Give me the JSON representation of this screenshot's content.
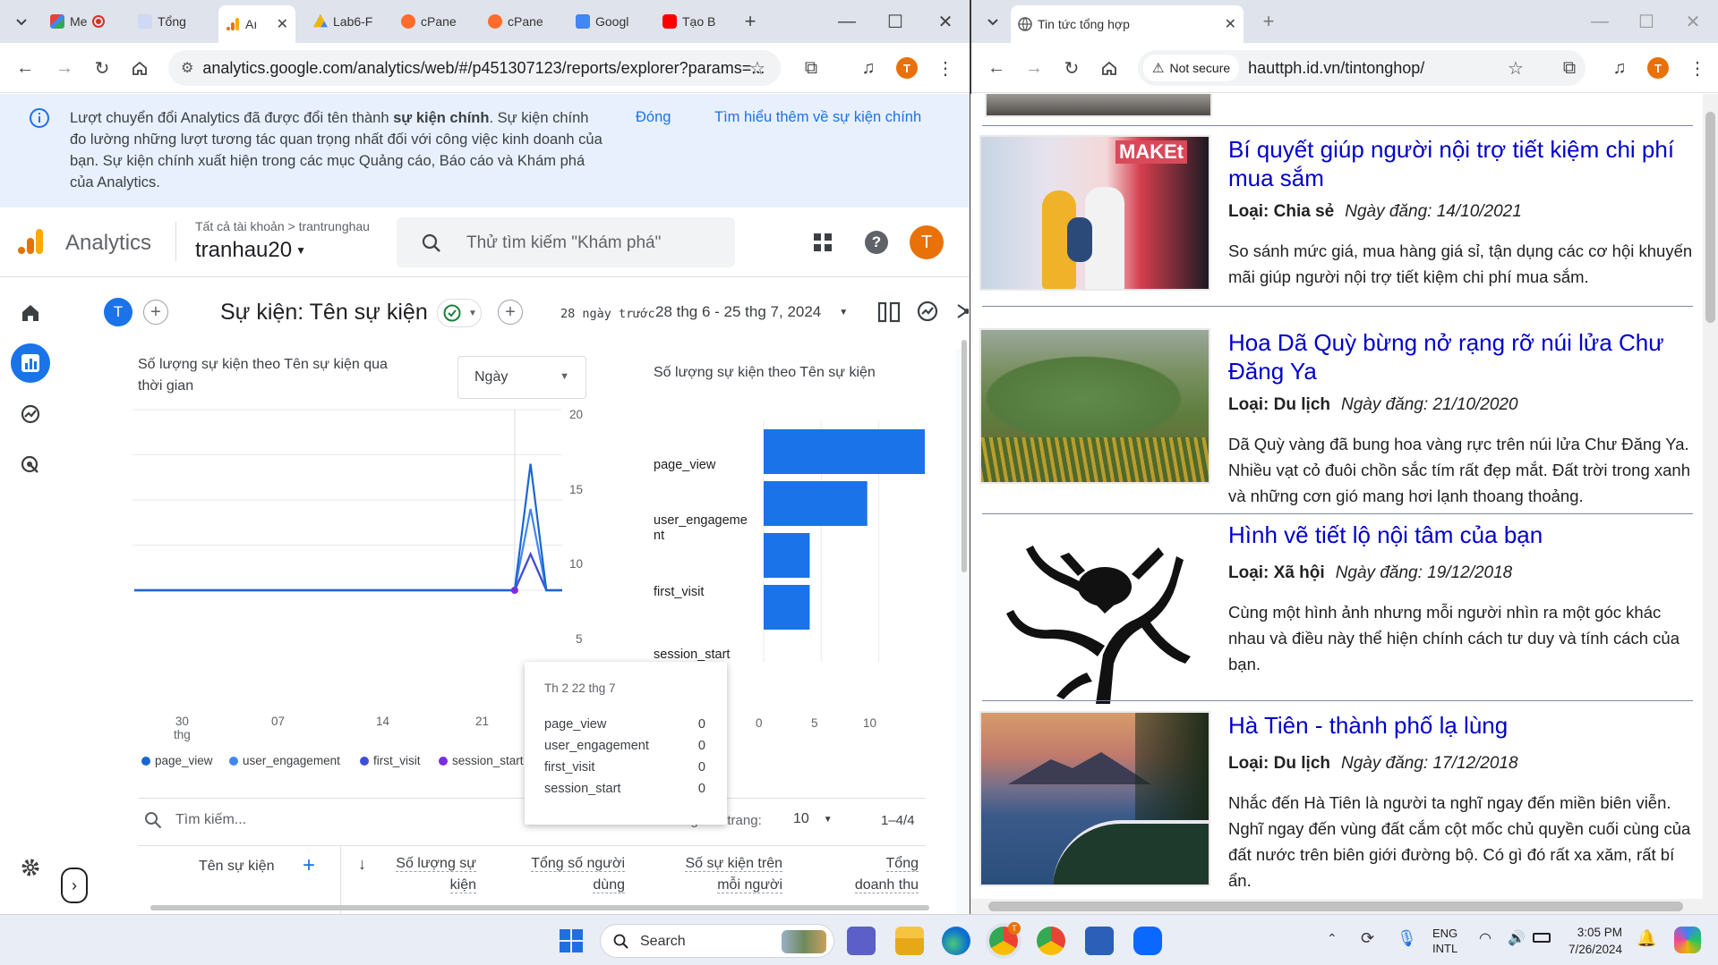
{
  "left_window": {
    "tabs": [
      {
        "label": "Me"
      },
      {
        "label": "Tổng"
      },
      {
        "label": "Aı"
      },
      {
        "label": "Lab6-F"
      },
      {
        "label": "cPane"
      },
      {
        "label": "cPane"
      },
      {
        "label": "Googl"
      },
      {
        "label": "Tạo B"
      }
    ],
    "url": "analytics.google.com/analytics/web/#/p451307123/reports/explorer?params=...",
    "avatar_letter": "T"
  },
  "right_window": {
    "tab_title": "Tin tức tổng hợp",
    "security_label": "Not secure",
    "url": "hauttph.id.vn/tintonghop/",
    "avatar_letter": "T"
  },
  "banner": {
    "text_1": "Lượt chuyển đổi Analytics đã được đổi tên thành ",
    "text_bold": "sự kiện chính",
    "text_2": ". Sự kiện chính đo lường những lượt tương tác quan trọng nhất đối với công việc kinh doanh của bạn. Sự kiện chính xuất hiện trong các mục Quảng cáo, Báo cáo và Khám phá của Analytics.",
    "dismiss": "Đóng",
    "learn_more": "Tìm hiểu thêm về sự kiện chính"
  },
  "ga_header": {
    "app_name": "Analytics",
    "breadcrumb": "Tất cả tài khoản > trantrunghau",
    "property": "tranhau20",
    "search_placeholder": "Thử tìm kiếm \"Khám phá\"",
    "avatar_letter": "T"
  },
  "report": {
    "avatar_letter": "T",
    "title": "Sự kiện: Tên sự kiện",
    "date_prefix": "28 ngày trước",
    "date_range": "28 thg 6 - 25 thg 7, 2024"
  },
  "line_chart": {
    "title": "Số lượng sự kiện theo Tên sự kiện qua thời gian",
    "granularity": "Ngày",
    "y_ticks": [
      "20",
      "15",
      "10",
      "5"
    ],
    "x_ticks": [
      "30 thg",
      "07",
      "14",
      "21"
    ],
    "x_tick_first_line1": "30",
    "x_tick_first_line2": "thg",
    "legend": [
      "page_view",
      "user_engagement",
      "first_visit",
      "session_start"
    ]
  },
  "chart_data": [
    {
      "type": "line",
      "title": "Số lượng sự kiện theo Tên sự kiện qua thời gian",
      "x": [
        "28/6",
        "29/6",
        "30/6",
        "1/7",
        "2/7",
        "3/7",
        "4/7",
        "5/7",
        "6/7",
        "7/7",
        "8/7",
        "9/7",
        "10/7",
        "11/7",
        "12/7",
        "13/7",
        "14/7",
        "15/7",
        "16/7",
        "17/7",
        "18/7",
        "19/7",
        "20/7",
        "21/7",
        "22/7",
        "23/7",
        "24/7",
        "25/7"
      ],
      "ylim": [
        0,
        20
      ],
      "series": [
        {
          "name": "page_view",
          "color": "#1967d2",
          "values": [
            0,
            0,
            0,
            0,
            0,
            0,
            0,
            0,
            0,
            0,
            0,
            0,
            0,
            0,
            0,
            0,
            0,
            0,
            0,
            0,
            0,
            0,
            0,
            0,
            0,
            14,
            0,
            0
          ]
        },
        {
          "name": "user_engagement",
          "color": "#4285f4",
          "values": [
            0,
            0,
            0,
            0,
            0,
            0,
            0,
            0,
            0,
            0,
            0,
            0,
            0,
            0,
            0,
            0,
            0,
            0,
            0,
            0,
            0,
            0,
            0,
            0,
            0,
            9,
            0,
            0
          ]
        },
        {
          "name": "first_visit",
          "color": "#3d4fd6",
          "values": [
            0,
            0,
            0,
            0,
            0,
            0,
            0,
            0,
            0,
            0,
            0,
            0,
            0,
            0,
            0,
            0,
            0,
            0,
            0,
            0,
            0,
            0,
            0,
            0,
            0,
            4,
            0,
            0
          ]
        },
        {
          "name": "session_start",
          "color": "#7b2ee0",
          "values": [
            0,
            0,
            0,
            0,
            0,
            0,
            0,
            0,
            0,
            0,
            0,
            0,
            0,
            0,
            0,
            0,
            0,
            0,
            0,
            0,
            0,
            0,
            0,
            0,
            0,
            4,
            0,
            0
          ]
        }
      ]
    },
    {
      "type": "bar",
      "title": "Số lượng sự kiện theo Tên sự kiện",
      "categories": [
        "page_view",
        "user_engagement",
        "first_visit",
        "session_start"
      ],
      "values": [
        14,
        9,
        4,
        4
      ],
      "x_ticks": [
        "0",
        "5",
        "10"
      ],
      "xlim": [
        0,
        14
      ],
      "color": "#1a73e8"
    }
  ],
  "bar_chart": {
    "title": "Số lượng sự kiện theo Tên sự kiện",
    "label_user_engagement_line1": "user_engageme",
    "label_user_engagement_line2": "nt"
  },
  "tooltip": {
    "date": "Th 2 22 thg 7",
    "rows": [
      {
        "name": "page_view",
        "value": "0"
      },
      {
        "name": "user_engagement",
        "value": "0"
      },
      {
        "name": "first_visit",
        "value": "0"
      },
      {
        "name": "session_start",
        "value": "0"
      }
    ]
  },
  "table": {
    "search_placeholder": "Tìm kiếm...",
    "rows_per_page_label": "Số hàng mỗi trang:",
    "rows_per_page": "10",
    "pagination": "1–4/4",
    "col_event_name": "Tên sự kiện",
    "col_event_count_1": "Số lượng sự",
    "col_event_count_2": "kiện",
    "col_total_users_1": "Tổng số người",
    "col_total_users_2": "dùng",
    "col_per_user_1": "Số sự kiện trên",
    "col_per_user_2": "mỗi người",
    "col_revenue_1": "Tổng",
    "col_revenue_2": "doanh thu"
  },
  "articles": [
    {
      "title": "Bí quyết giúp người nội trợ tiết kiệm chi phí mua sắm",
      "category_label": "Loại: Chia sẻ",
      "date": "Ngày đăng: 14/10/2021",
      "description": "So sánh mức giá, mua hàng giá sỉ, tận dụng các cơ hội khuyến mãi giúp người nội trợ tiết kiệm chi phí mua sắm.",
      "image_text": "MAKEt"
    },
    {
      "title": "Hoa Dã Quỳ bừng nở rạng rỡ núi lửa Chư Đăng Ya",
      "category_label": "Loại: Du lịch",
      "date": "Ngày đăng: 21/10/2020",
      "description": "Dã Quỳ vàng đã bung hoa vàng rực trên núi lửa Chư Đăng Ya. Nhiều vạt cỏ đuôi chồn sắc tím rất đẹp mắt. Đất trời trong xanh và những cơn gió mang hơi lạnh thoang thoảng."
    },
    {
      "title": "Hình vẽ tiết lộ nội tâm của bạn",
      "category_label": "Loại: Xã hội",
      "date": "Ngày đăng: 19/12/2018",
      "description": "Cùng một hình ảnh nhưng mỗi người nhìn ra một góc khác nhau và điều này thể hiện chính cách tư duy và tính cách của bạn."
    },
    {
      "title": "Hà Tiên - thành phố lạ lùng",
      "category_label": "Loại: Du lịch",
      "date": "Ngày đăng: 17/12/2018",
      "description": "Nhắc đến Hà Tiên là người ta nghĩ ngay đến miền biên viễn. Nghĩ ngay đến vùng đất cắm cột mốc chủ quyền cuối cùng của đất nước trên biên giới đường bộ. Có gì đó rất xa xăm, rất bí ẩn."
    }
  ],
  "taskbar": {
    "search_label": "Search",
    "lang_1": "ENG",
    "lang_2": "INTL",
    "time": "3:05 PM",
    "date": "7/26/2024",
    "chrome_badge": "T"
  }
}
